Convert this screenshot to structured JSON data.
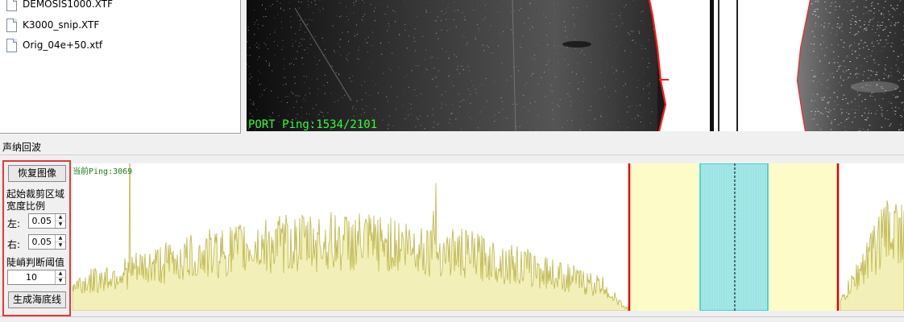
{
  "files": [
    {
      "name": "DEMOSIS1000.XTF",
      "icon": "file-icon"
    },
    {
      "name": "K3000_snip.XTF",
      "icon": "file-icon"
    },
    {
      "name": "Orig_04e+50.xtf",
      "icon": "file-icon"
    }
  ],
  "sonar": {
    "ping_readout": "PORT Ping:1534/2101",
    "ping_current": 1534,
    "ping_total": 2101,
    "bottom_line_color": "#ff1a1a"
  },
  "echo_panel": {
    "title": "声纳回波",
    "current_ping_label": "当前Ping:3069"
  },
  "controls": {
    "restore_button": "恢复图像",
    "crop_label_line1": "起始裁剪区域",
    "crop_label_line2": "宽度比例",
    "left_label": "左:",
    "left_value": "0.05",
    "right_label": "右:",
    "right_value": "0.05",
    "threshold_label": "陡峭判断阈值",
    "threshold_value": "10",
    "generate_button": "生成海底线",
    "highlight_color": "#e53935"
  },
  "colors": {
    "waveform": "#c8c060",
    "crop_region": "#fdfcc8",
    "center_region": "#9fe6e6",
    "boundary": "#e00000"
  }
}
